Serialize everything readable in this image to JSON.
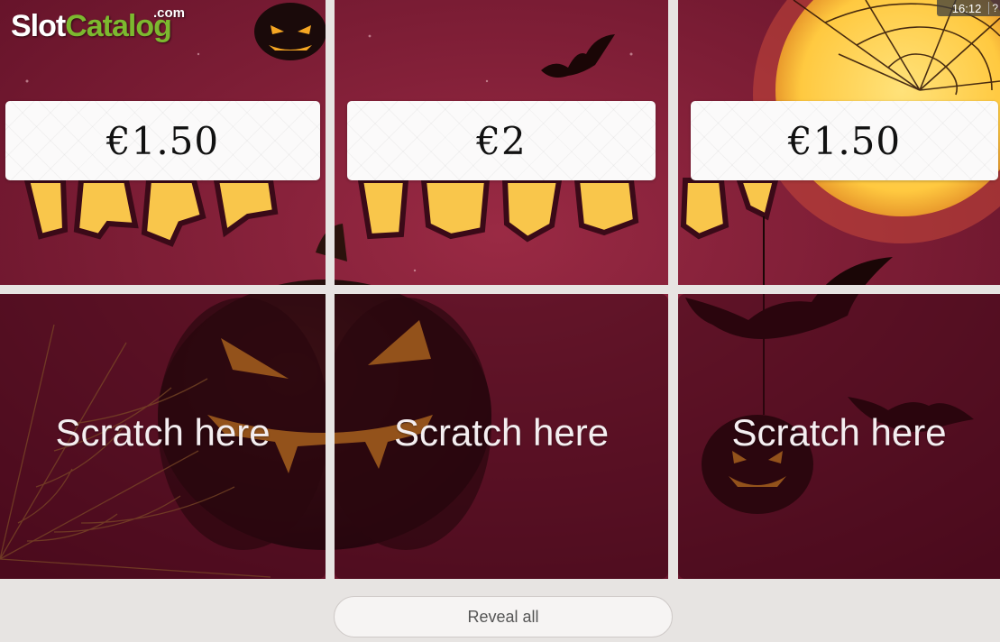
{
  "branding": {
    "logo_part1": "Slot",
    "logo_part2": "Catalog",
    "logo_suffix": ".com"
  },
  "status": {
    "clock": "16:12",
    "help_icon": "?"
  },
  "tiles": [
    {
      "state": "revealed",
      "prize": "€1.50"
    },
    {
      "state": "revealed",
      "prize": "€2"
    },
    {
      "state": "revealed",
      "prize": "€1.50"
    },
    {
      "state": "hidden",
      "label": "Scratch here"
    },
    {
      "state": "hidden",
      "label": "Scratch here"
    },
    {
      "state": "hidden",
      "label": "Scratch here"
    }
  ],
  "controls": {
    "reveal_all_label": "Reveal all"
  },
  "colors": {
    "background_sky": "#7a1a32",
    "pumpkin_orange": "#f5a623",
    "halloween_letters": "#f9c64b",
    "moon": "#ffd45a",
    "logo_green": "#7cb92f",
    "page_background": "#e7e4e2"
  },
  "scene_icons": [
    "pumpkin-icon",
    "bat-icon",
    "spiderweb-icon",
    "moon-icon"
  ]
}
